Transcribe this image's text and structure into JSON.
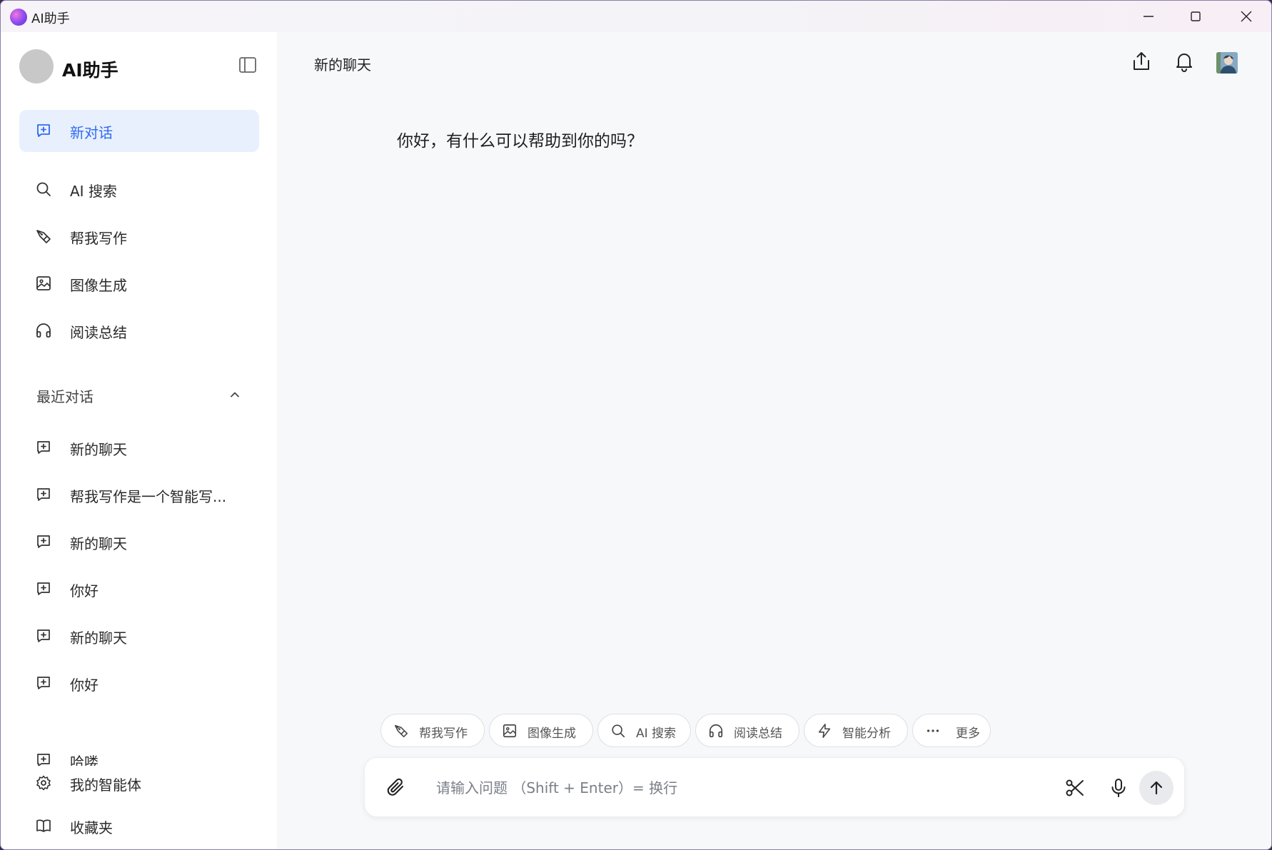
{
  "window": {
    "title": "AI助手"
  },
  "sidebar": {
    "brand": "AI助手",
    "new_chat": "新对话",
    "nav": [
      {
        "label": "AI 搜索",
        "icon": "search-icon"
      },
      {
        "label": "帮我写作",
        "icon": "pen-icon"
      },
      {
        "label": "图像生成",
        "icon": "image-icon"
      },
      {
        "label": "阅读总结",
        "icon": "headphones-icon"
      }
    ],
    "recent_title": "最近对话",
    "recent": [
      "新的聊天",
      "帮我写作是一个智能写...",
      "新的聊天",
      "你好",
      "新的聊天",
      "你好",
      "哈喽"
    ],
    "footer": [
      {
        "label": "我的智能体",
        "icon": "gear-icon"
      },
      {
        "label": "收藏夹",
        "icon": "book-icon"
      }
    ]
  },
  "main": {
    "chat_title": "新的聊天",
    "greeting": "你好，有什么可以帮助到你的吗？",
    "chips": [
      {
        "label": "帮我写作",
        "icon": "pen-icon"
      },
      {
        "label": "图像生成",
        "icon": "image-icon"
      },
      {
        "label": "AI 搜索",
        "icon": "search-icon"
      },
      {
        "label": "阅读总结",
        "icon": "headphones-icon"
      },
      {
        "label": "智能分析",
        "icon": "lightning-icon"
      },
      {
        "label": "更多",
        "icon": "more-icon"
      }
    ],
    "composer": {
      "placeholder": "请输入问题 （Shift + Enter）= 换行",
      "value": ""
    }
  },
  "colors": {
    "accent": "#2f6bef",
    "new_chat_bg": "#e9f0fd",
    "sidebar_bg": "#ffffff",
    "main_bg": "#f7f8fa"
  }
}
